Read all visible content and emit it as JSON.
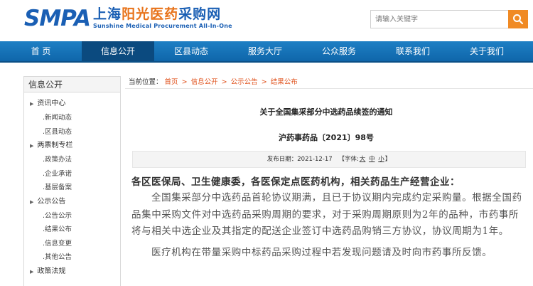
{
  "header": {
    "logo_main": "SMPA",
    "logo_cn_part1": "上海",
    "logo_cn_highlight": "阳光医药",
    "logo_cn_part2": "采购网",
    "logo_en": "Sunshine Medical Procurement All-In-One",
    "search_placeholder": "请输入关键字",
    "search_icon": "search-icon"
  },
  "colors": {
    "brand_blue": "#1a5fb4",
    "brand_orange": "#e8731a",
    "nav_bg": "#1170b5",
    "nav_active": "#0b4a7f",
    "link_red": "#e0531e",
    "search_button": "#f08a24"
  },
  "nav": {
    "items": [
      {
        "label": "首 页"
      },
      {
        "label": "信息公开",
        "active": true
      },
      {
        "label": "区县动态"
      },
      {
        "label": "服务大厅"
      },
      {
        "label": "公众服务"
      },
      {
        "label": "联系我们"
      },
      {
        "label": "关于我们"
      }
    ]
  },
  "sidebar": {
    "title": "信息公开",
    "groups": [
      {
        "label": "资讯中心",
        "subs": [
          ".新闻动态",
          ".区县动态"
        ]
      },
      {
        "label": "两票制专栏",
        "subs": [
          ".政策办法",
          ".企业承诺",
          ".基层备案"
        ]
      },
      {
        "label": "公示公告",
        "subs": [
          ".公告公示",
          ".结果公布",
          ".信息变更",
          ".其他公告"
        ]
      },
      {
        "label": "政策法规",
        "subs": []
      }
    ]
  },
  "breadcrumb": {
    "prefix": "当前位置：",
    "items": [
      "首页",
      "信息公开",
      "公示公告",
      "结果公布"
    ],
    "separator": ">"
  },
  "article": {
    "title": "关于全国集采部分中选药品续签的通知",
    "doc_number": "沪药事药品〔2021〕98号",
    "date_label": "发布日期：2021-12-17",
    "font_label_open": "【字体:",
    "font_sizes": [
      "大",
      "中",
      "小"
    ],
    "font_label_close": "】",
    "salutation": "各区医保局、卫生健康委，各医保定点医药机构，相关药品生产经营企业：",
    "paragraph1": "全国集采部分中选药品首轮协议期满，且已于协议期内完成约定采购量。根据全国药品集中采购文件对中选药品采购周期的要求，对于采购周期原则为2年的品种，市药事所将与相关中选企业及其指定的配送企业签订中选药品购销三方协议，协议周期为1年。",
    "paragraph2": "医疗机构在带量采购中标药品采购过程中若发现问题请及时向市药事所反馈。"
  }
}
